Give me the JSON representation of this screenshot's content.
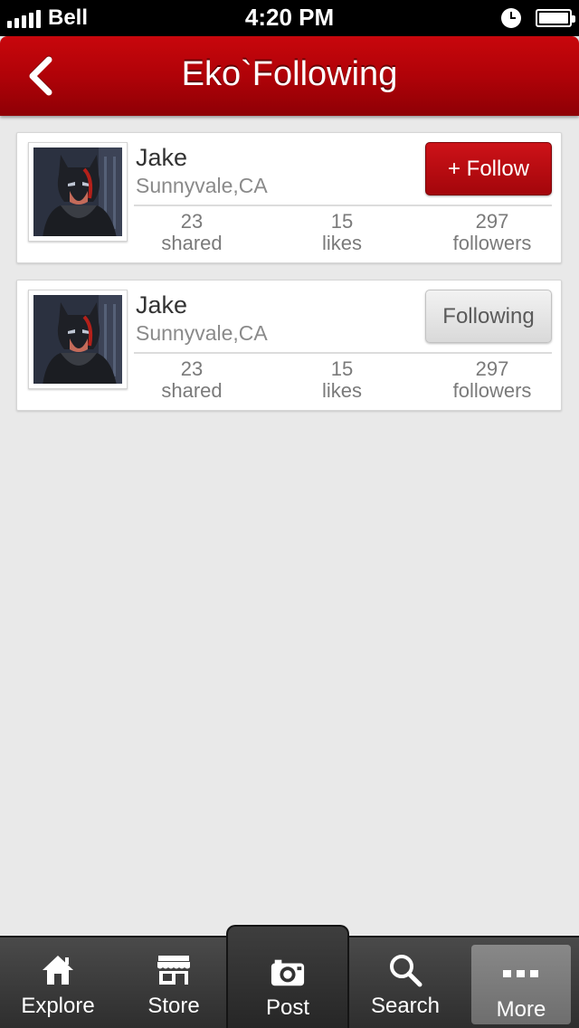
{
  "status_bar": {
    "carrier": "Bell",
    "time": "4:20 PM",
    "icons": [
      "signal-icon",
      "clock-icon",
      "battery-icon"
    ]
  },
  "nav": {
    "title": "Eko`Following",
    "back_icon": "chevron-left-icon"
  },
  "users": [
    {
      "name": "Jake",
      "location": "Sunnyvale,CA",
      "button_label": "+ Follow",
      "is_following": false,
      "stats": {
        "shared_count": "23",
        "shared_label": "shared",
        "likes_count": "15",
        "likes_label": "likes",
        "followers_count": "297",
        "followers_label": "followers"
      }
    },
    {
      "name": "Jake",
      "location": "Sunnyvale,CA",
      "button_label": "Following",
      "is_following": true,
      "stats": {
        "shared_count": "23",
        "shared_label": "shared",
        "likes_count": "15",
        "likes_label": "likes",
        "followers_count": "297",
        "followers_label": "followers"
      }
    }
  ],
  "tab_bar": {
    "tabs": [
      {
        "label": "Explore",
        "icon": "house-icon"
      },
      {
        "label": "Store",
        "icon": "storefront-icon"
      },
      {
        "label": "Post",
        "icon": "camera-icon"
      },
      {
        "label": "Search",
        "icon": "magnifier-icon"
      },
      {
        "label": "More",
        "icon": "more-dots-icon"
      }
    ],
    "active": "More"
  },
  "colors": {
    "brand_red": "#b00208",
    "background": "#e9e9e9",
    "tab_bar": "#3a3a3a"
  }
}
